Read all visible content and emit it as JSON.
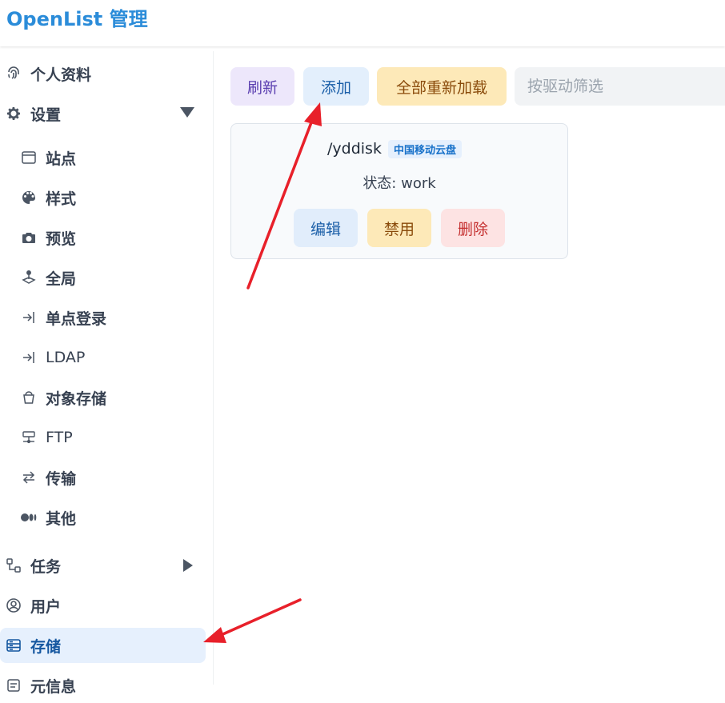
{
  "header": {
    "title": "OpenList 管理"
  },
  "sidebar": {
    "items": [
      {
        "label": "个人资料",
        "icon": "fingerprint-icon"
      },
      {
        "label": "设置",
        "icon": "gear-icon"
      },
      {
        "label": "站点",
        "icon": "window-icon"
      },
      {
        "label": "样式",
        "icon": "palette-icon"
      },
      {
        "label": "预览",
        "icon": "camera-icon"
      },
      {
        "label": "全局",
        "icon": "joystick-icon"
      },
      {
        "label": "单点登录",
        "icon": "login-arrow-icon"
      },
      {
        "label": "LDAP",
        "icon": "login-arrow-icon"
      },
      {
        "label": "对象存储",
        "icon": "bucket-icon"
      },
      {
        "label": "FTP",
        "icon": "network-icon"
      },
      {
        "label": "传输",
        "icon": "transfer-icon"
      },
      {
        "label": "其他",
        "icon": "dots-icon"
      },
      {
        "label": "任务",
        "icon": "task-flow-icon"
      },
      {
        "label": "用户",
        "icon": "user-circle-icon"
      },
      {
        "label": "存储",
        "icon": "storage-icon"
      },
      {
        "label": "元信息",
        "icon": "meta-icon"
      }
    ]
  },
  "toolbar": {
    "refresh_label": "刷新",
    "add_label": "添加",
    "reload_all_label": "全部重新加载",
    "filter_placeholder": "按驱动筛选"
  },
  "storage_card": {
    "mount_path": "/yddisk",
    "driver": "中国移动云盘",
    "status": "状态: work",
    "edit_label": "编辑",
    "disable_label": "禁用",
    "delete_label": "删除"
  },
  "colors": {
    "brand": "#2b8cd9",
    "active_bg": "#e6f0fd",
    "annotation_arrow": "#e8202a"
  }
}
